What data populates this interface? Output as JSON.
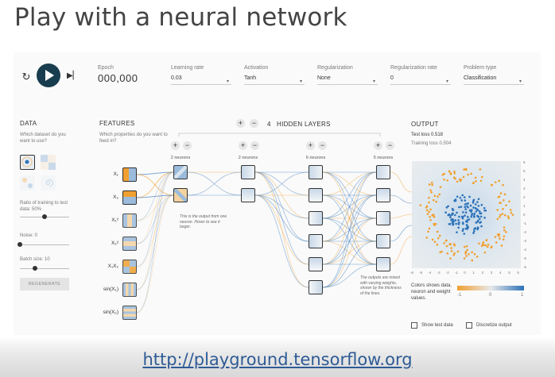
{
  "slide": {
    "title": "Play with a neural network",
    "footer_link": "http://playground.tensorflow.org"
  },
  "toolbar": {
    "reset_icon": "reset-icon",
    "play_icon": "play-icon",
    "step_icon": "step-forward-icon",
    "epoch_label": "Epoch",
    "epoch_value": "000,000",
    "learning_rate_label": "Learning rate",
    "learning_rate_value": "0.03",
    "activation_label": "Activation",
    "activation_value": "Tanh",
    "regularization_label": "Regularization",
    "regularization_value": "None",
    "regularization_rate_label": "Regularization rate",
    "regularization_rate_value": "0",
    "problem_type_label": "Problem type",
    "problem_type_value": "Classification"
  },
  "data_panel": {
    "heading": "DATA",
    "question": "Which dataset do you want to use?",
    "ratio_label": "Ratio of training to test data:  50%",
    "ratio_value": 0.5,
    "noise_label": "Noise:  0",
    "noise_value": 0,
    "batch_label": "Batch size:  10",
    "batch_value": 0.3,
    "regenerate_label": "REGENERATE"
  },
  "features_panel": {
    "heading": "FEATURES",
    "question": "Which properties do you want to feed in?",
    "features": [
      "X₁",
      "X₂",
      "X₁²",
      "X₂²",
      "X₁X₂",
      "sin(X₁)",
      "sin(X₂)"
    ]
  },
  "network": {
    "hidden_layers_count": "4",
    "hidden_layers_label": "HIDDEN LAYERS",
    "layers": [
      {
        "neurons_label": "2 neurons"
      },
      {
        "neurons_label": "2 neurons"
      },
      {
        "neurons_label": "6 neurons"
      },
      {
        "neurons_label": "5 neurons"
      }
    ],
    "annotation_node": "This is the output from one neuron. Hover to see it larger.",
    "annotation_outputs": "The outputs are mixed with varying weights, shown by the thickness of the lines."
  },
  "output_panel": {
    "heading": "OUTPUT",
    "test_loss": "Test loss 0.518",
    "training_loss": "Training loss 0.504",
    "colors_text": "Colors shows data, neuron and weight values.",
    "scale_labels": [
      "-1",
      "0",
      "1"
    ],
    "x_ticks": [
      "-6",
      "-5",
      "-4",
      "-3",
      "-2",
      "-1",
      "0",
      "1",
      "2",
      "3",
      "4",
      "5",
      "6"
    ],
    "y_ticks": [
      "6",
      "5",
      "4",
      "3",
      "2",
      "1",
      "0",
      "-1",
      "-2",
      "-3",
      "-4",
      "-5",
      "-6"
    ],
    "show_test_label": "Show test data",
    "discretize_label": "Discretize output"
  },
  "colors": {
    "positive": "#2d72b8",
    "negative": "#f0a030",
    "play_button": "#183d4e",
    "link": "#2e5b95"
  }
}
